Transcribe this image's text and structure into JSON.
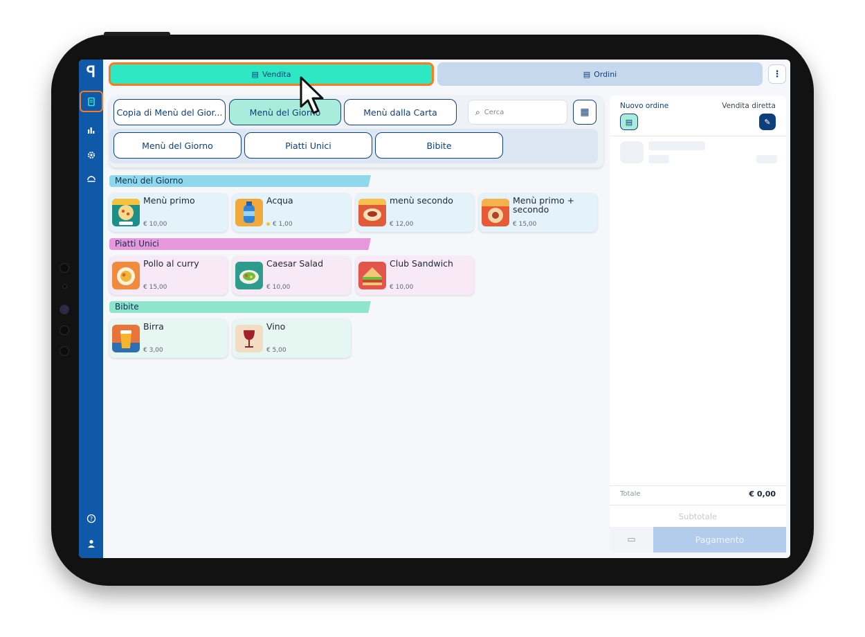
{
  "app": {
    "logo": "ꟼ"
  },
  "tabs": {
    "vendita": "Vendita",
    "ordini": "Ordini"
  },
  "categories": {
    "copy": "Copia di Menù del Gior...",
    "menu_giorno": "Menù del Giorno",
    "menu_carta": "Menù dalla Carta"
  },
  "subcategories": [
    "Menù del Giorno",
    "Piatti Unici",
    "Bibite"
  ],
  "search": {
    "placeholder": "Cerca"
  },
  "sections": [
    {
      "title": "Menù del Giorno",
      "color": "#8fd7ea",
      "card_color": "#e4f3fa",
      "items": [
        {
          "name": "Menù primo",
          "price": "€ 10,00"
        },
        {
          "name": "Acqua",
          "price": "€ 1,00"
        },
        {
          "name": "menù secondo",
          "price": "€ 12,00"
        },
        {
          "name": "Menù primo + secondo",
          "price": "€ 15,00"
        }
      ]
    },
    {
      "title": "Piatti Unici",
      "color": "#e797dc",
      "card_color": "#f7e9f5",
      "items": [
        {
          "name": "Pollo al curry",
          "price": "€ 15,00"
        },
        {
          "name": "Caesar Salad",
          "price": "€ 10,00"
        },
        {
          "name": "Club Sandwich",
          "price": "€ 10,00"
        }
      ]
    },
    {
      "title": "Bibite",
      "color": "#8fe5cc",
      "card_color": "#e6f6f1",
      "items": [
        {
          "name": "Birra",
          "price": "€ 3,00"
        },
        {
          "name": "Vino",
          "price": "€ 5,00"
        }
      ]
    }
  ],
  "order_panel": {
    "new_order": "Nuovo ordine",
    "direct_sale": "Vendita diretta",
    "total_label": "Totale",
    "total_value": "€ 0,00",
    "subtotal": "Subtotale",
    "pay": "Pagamento"
  },
  "colors": {
    "nav": "#1059a8",
    "accent": "#2ee8c4",
    "highlight": "#ff7a1a",
    "primary_text": "#0f3f7a"
  },
  "icons": {
    "nav": [
      "receipt-icon",
      "bar-chart-icon",
      "settings-icon",
      "menu-book-icon",
      "help-icon",
      "user-icon"
    ]
  }
}
